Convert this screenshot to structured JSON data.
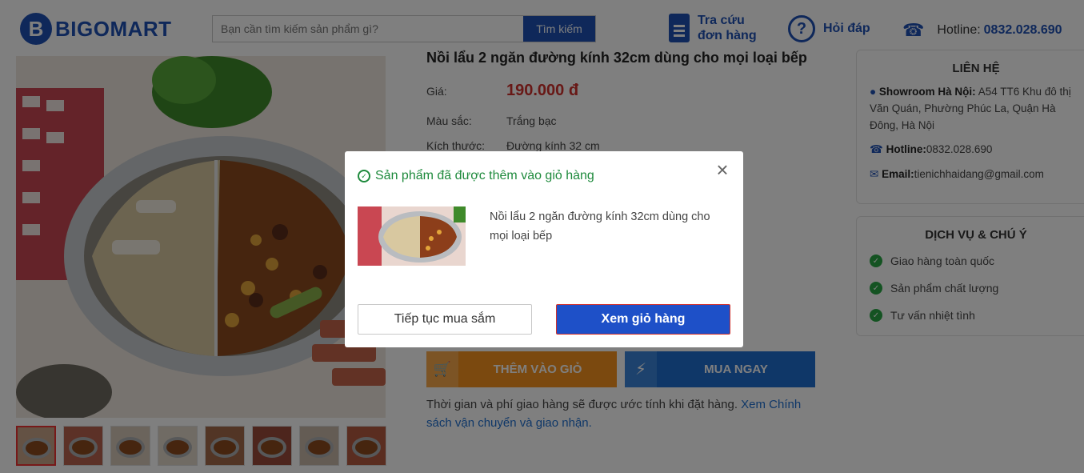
{
  "brand": {
    "logo_letter": "B",
    "name": "BIGOMART",
    "color": "#1e50b4"
  },
  "search": {
    "placeholder": "Bạn cần tìm kiếm sản phẩm gì?",
    "button_label": "Tìm kiếm"
  },
  "header_links": {
    "track_line1": "Tra cứu",
    "track_line2": "đơn hàng",
    "faq_label": "Hỏi đáp",
    "hotline_label": "Hotline:",
    "hotline_number": "0832.028.690"
  },
  "product": {
    "title": "Nồi lẩu 2 ngăn đường kính 32cm dùng cho mọi loại bếp",
    "price_label": "Giá:",
    "price": "190.000 đ",
    "color_label": "Màu sắc:",
    "color_value": "Trắng bạc",
    "size_label": "Kích thước:",
    "size_value": "Đường kính 32 cm",
    "thumb_count": 8,
    "add_to_cart_label": "THÊM VÀO GIỎ",
    "buy_now_label": "MUA NGAY",
    "shipping_note": "Thời gian và phí giao hàng sẽ được ước tính khi đặt hàng.",
    "shipping_link": "Xem Chính sách vận chuyển và giao nhận."
  },
  "contact": {
    "heading": "LIÊN HỆ",
    "showroom_label": "Showroom Hà Nội:",
    "showroom_address": "A54 TT6 Khu đô thị Văn Quán, Phường Phúc La, Quận Hà Đông, Hà Nội",
    "hotline_label": "Hotline:",
    "hotline_value": "0832.028.690",
    "email_label": "Email:",
    "email_value": "tienichhaidang@gmail.com"
  },
  "services": {
    "heading": "DỊCH VỤ & CHÚ Ý",
    "items": [
      "Giao hàng toàn quốc",
      "Sản phẩm chất lượng",
      "Tư vấn nhiệt tình"
    ]
  },
  "modal": {
    "message": "Sản phẩm đã được thêm vào giỏ hàng",
    "product_name": "Nồi lẩu 2 ngăn đường kính 32cm dùng cho mọi loại bếp",
    "continue_label": "Tiếp tục mua sắm",
    "view_cart_label": "Xem giỏ hàng",
    "success_color": "#1e8a3c",
    "primary_color": "#1e50c8"
  }
}
